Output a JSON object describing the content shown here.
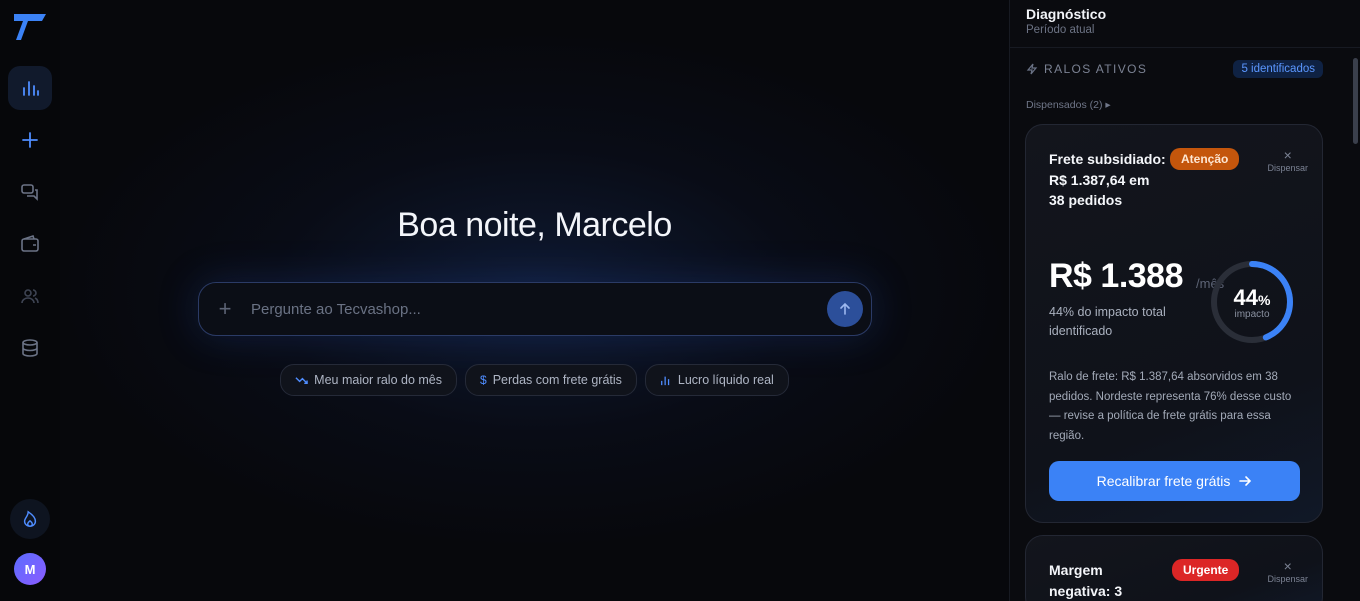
{
  "sidebar": {
    "items": [
      {
        "icon": "bar-chart-icon",
        "active": true
      },
      {
        "icon": "plus-icon",
        "active": false
      },
      {
        "icon": "chat-icon",
        "active": false
      },
      {
        "icon": "wallet-icon",
        "active": false
      },
      {
        "icon": "users-icon",
        "active": false
      },
      {
        "icon": "database-icon",
        "active": false
      }
    ],
    "fire_icon": "flame-icon",
    "avatar_initial": "M"
  },
  "main": {
    "greeting": "Boa noite, Marcelo",
    "search": {
      "placeholder": "Pergunte ao Tecvashop..."
    },
    "suggestions": [
      {
        "icon": "trending-down-icon",
        "label": "Meu maior ralo do mês"
      },
      {
        "icon": "dollar-icon",
        "label": "Perdas com frete grátis"
      },
      {
        "icon": "bar-chart-icon",
        "label": "Lucro líquido real"
      }
    ]
  },
  "panel": {
    "title": "Diagnóstico",
    "subtitle": "Período atual",
    "section_label": "RALOS ATIVOS",
    "identified_badge": "5 identificados",
    "dismissed_label": "Dispensados (2) ▸",
    "cards": [
      {
        "title": "Frete subsidiado: R$ 1.387,64 em 38 pedidos",
        "badge": "Atenção",
        "dismiss_label": "Dispensar",
        "amount": "R$ 1.388",
        "period": "/mês",
        "impact_text": "44% do impacto total identificado",
        "impact_value": "44",
        "impact_unit": "%",
        "impact_label": "impacto",
        "impact_fraction": 0.44,
        "description": "Ralo de frete: R$ 1.387,64 absorvidos em 38 pedidos. Nordeste representa 76% desse custo — revise a política de frete grátis para essa região.",
        "cta": "Recalibrar frete grátis"
      },
      {
        "title": "Margem negativa: 3",
        "badge": "Urgente",
        "dismiss_label": "Dispensar"
      }
    ]
  },
  "colors": {
    "accent": "#3b82f6",
    "attention": "#c4560c",
    "urgent": "#dc2626"
  }
}
